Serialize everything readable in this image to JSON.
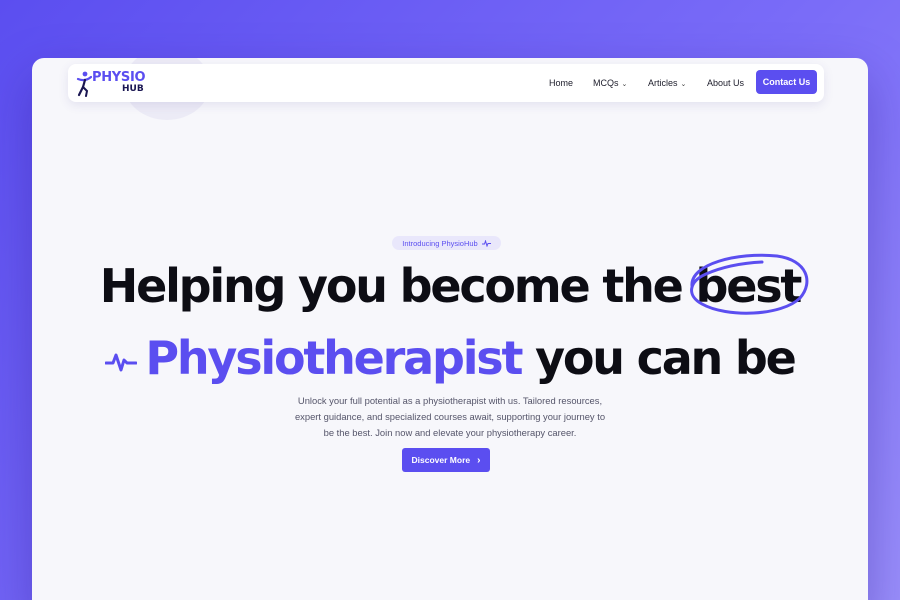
{
  "brand": {
    "logo_line1": "PHYSIO",
    "logo_line2": "HUB",
    "primary_color": "#5b4ef0"
  },
  "nav": {
    "items": [
      {
        "label": "Home",
        "has_dropdown": false
      },
      {
        "label": "MCQs",
        "has_dropdown": true
      },
      {
        "label": "Articles",
        "has_dropdown": true
      },
      {
        "label": "About Us",
        "has_dropdown": false
      }
    ],
    "cta_label": "Contact Us"
  },
  "hero": {
    "badge": "Introducing PhysioHub",
    "headline_line1_main": "Helping you become the ",
    "headline_line1_highlight": "best",
    "headline_line2_accent": "Physiotherapist",
    "headline_line2_rest": " you can be",
    "description": "Unlock your full potential as a physiotherapist with us. Tailored resources, expert guidance, and specialized courses await, supporting your journey to be the best. Join now and elevate your physiotherapy career.",
    "button_label": "Discover More"
  },
  "icons": {
    "logo": "person-figure-icon",
    "dropdown": "chevron-down-icon",
    "badge": "heartbeat-pulse-icon",
    "headline": "heartbeat-pulse-icon",
    "button": "chevron-right-icon"
  }
}
